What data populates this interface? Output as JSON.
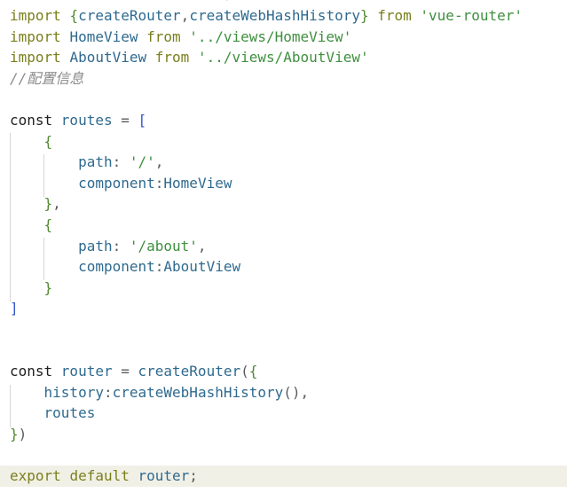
{
  "editor": {
    "top_fragment": ")",
    "lines": [
      {
        "segments": [
          {
            "t": "import ",
            "c": "kw-olive"
          },
          {
            "t": "{",
            "c": "brace"
          },
          {
            "t": "createRouter",
            "c": "ident"
          },
          {
            "t": ",",
            "c": "punct"
          },
          {
            "t": "createWebHashHistory",
            "c": "ident"
          },
          {
            "t": "}",
            "c": "brace"
          },
          {
            "t": " from ",
            "c": "kw-olive"
          },
          {
            "t": "'vue-router'",
            "c": "str"
          }
        ]
      },
      {
        "segments": [
          {
            "t": "import ",
            "c": "kw-olive"
          },
          {
            "t": "HomeView",
            "c": "ident"
          },
          {
            "t": " from ",
            "c": "kw-olive"
          },
          {
            "t": "'../views/HomeView'",
            "c": "str"
          }
        ]
      },
      {
        "segments": [
          {
            "t": "import ",
            "c": "kw-olive"
          },
          {
            "t": "AboutView",
            "c": "ident"
          },
          {
            "t": " from ",
            "c": "kw-olive"
          },
          {
            "t": "'../views/AboutView'",
            "c": "str"
          }
        ]
      },
      {
        "segments": [
          {
            "t": "//配置信息",
            "c": "comment"
          }
        ]
      },
      {
        "segments": []
      },
      {
        "segments": [
          {
            "t": "const ",
            "c": "kw-dark"
          },
          {
            "t": "routes",
            "c": "ident"
          },
          {
            "t": " = ",
            "c": "punct"
          },
          {
            "t": "[",
            "c": "bracket"
          }
        ]
      },
      {
        "segments": [
          {
            "t": "    ",
            "c": "punct"
          },
          {
            "t": "{",
            "c": "brace"
          }
        ]
      },
      {
        "segments": [
          {
            "t": "        ",
            "c": "punct"
          },
          {
            "t": "path",
            "c": "ident"
          },
          {
            "t": ": ",
            "c": "punct"
          },
          {
            "t": "'/'",
            "c": "str"
          },
          {
            "t": ",",
            "c": "punct"
          }
        ]
      },
      {
        "segments": [
          {
            "t": "        ",
            "c": "punct"
          },
          {
            "t": "component",
            "c": "ident"
          },
          {
            "t": ":",
            "c": "punct"
          },
          {
            "t": "HomeView",
            "c": "ident"
          }
        ]
      },
      {
        "segments": [
          {
            "t": "    ",
            "c": "punct"
          },
          {
            "t": "}",
            "c": "brace"
          },
          {
            "t": ",",
            "c": "punct"
          }
        ]
      },
      {
        "segments": [
          {
            "t": "    ",
            "c": "punct"
          },
          {
            "t": "{",
            "c": "brace"
          }
        ]
      },
      {
        "segments": [
          {
            "t": "        ",
            "c": "punct"
          },
          {
            "t": "path",
            "c": "ident"
          },
          {
            "t": ": ",
            "c": "punct"
          },
          {
            "t": "'/about'",
            "c": "str"
          },
          {
            "t": ",",
            "c": "punct"
          }
        ]
      },
      {
        "segments": [
          {
            "t": "        ",
            "c": "punct"
          },
          {
            "t": "component",
            "c": "ident"
          },
          {
            "t": ":",
            "c": "punct"
          },
          {
            "t": "AboutView",
            "c": "ident"
          }
        ]
      },
      {
        "segments": [
          {
            "t": "    ",
            "c": "punct"
          },
          {
            "t": "}",
            "c": "brace"
          }
        ]
      },
      {
        "segments": [
          {
            "t": "]",
            "c": "bracket"
          }
        ]
      },
      {
        "segments": []
      },
      {
        "segments": []
      },
      {
        "segments": [
          {
            "t": "const ",
            "c": "kw-dark"
          },
          {
            "t": "router",
            "c": "ident"
          },
          {
            "t": " = ",
            "c": "punct"
          },
          {
            "t": "createRouter",
            "c": "ident"
          },
          {
            "t": "(",
            "c": "punct"
          },
          {
            "t": "{",
            "c": "brace"
          }
        ]
      },
      {
        "segments": [
          {
            "t": "    ",
            "c": "punct"
          },
          {
            "t": "history",
            "c": "ident"
          },
          {
            "t": ":",
            "c": "punct"
          },
          {
            "t": "createWebHashHistory",
            "c": "ident"
          },
          {
            "t": "()",
            "c": "punct"
          },
          {
            "t": ",",
            "c": "punct"
          }
        ]
      },
      {
        "segments": [
          {
            "t": "    ",
            "c": "punct"
          },
          {
            "t": "routes",
            "c": "ident"
          }
        ]
      },
      {
        "segments": [
          {
            "t": "}",
            "c": "brace"
          },
          {
            "t": ")",
            "c": "punct"
          }
        ]
      },
      {
        "segments": []
      },
      {
        "segments": [
          {
            "t": "export ",
            "c": "kw-olive"
          },
          {
            "t": "default ",
            "c": "kw-olive"
          },
          {
            "t": "router",
            "c": "ident"
          },
          {
            "t": ";",
            "c": "punct"
          }
        ]
      }
    ],
    "highlighted_line": 22
  }
}
